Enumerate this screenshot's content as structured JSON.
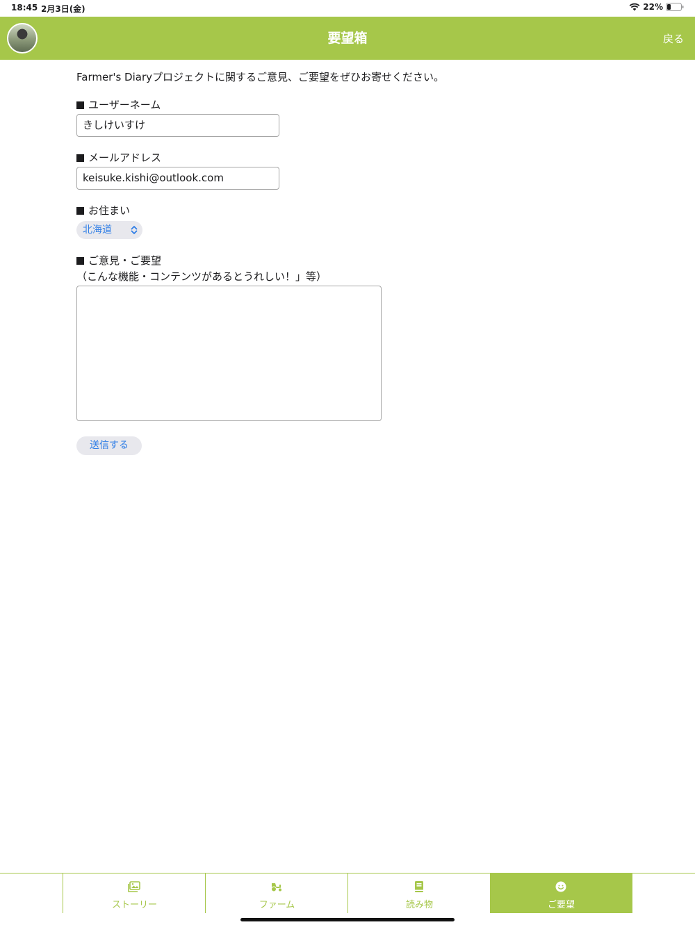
{
  "status_bar": {
    "time": "18:45",
    "date": "2月3日(金)",
    "battery": "22%"
  },
  "header": {
    "title": "要望箱",
    "back": "戻る"
  },
  "form": {
    "intro": "Farmer's Diaryプロジェクトに関するご意見、ご要望をぜひお寄せください。",
    "username_label": "ユーザーネーム",
    "username_value": "きしけいすけ",
    "email_label": "メールアドレス",
    "email_value": "keisuke.kishi@outlook.com",
    "residence_label": "お住まい",
    "residence_value": "北海道",
    "feedback_label": "ご意見・ご要望",
    "feedback_hint": "（こんな機能・コンテンツがあるとうれしい！」等）",
    "feedback_value": "",
    "submit_label": "送信する"
  },
  "tabs": [
    {
      "label": "ストーリー",
      "icon": "photo-icon",
      "active": false
    },
    {
      "label": "ファーム",
      "icon": "tractor-icon",
      "active": false
    },
    {
      "label": "読み物",
      "icon": "book-icon",
      "active": false
    },
    {
      "label": "ご要望",
      "icon": "smile-icon",
      "active": true
    }
  ],
  "colors": {
    "brand": "#a6c74a",
    "link": "#2f7ee6"
  }
}
